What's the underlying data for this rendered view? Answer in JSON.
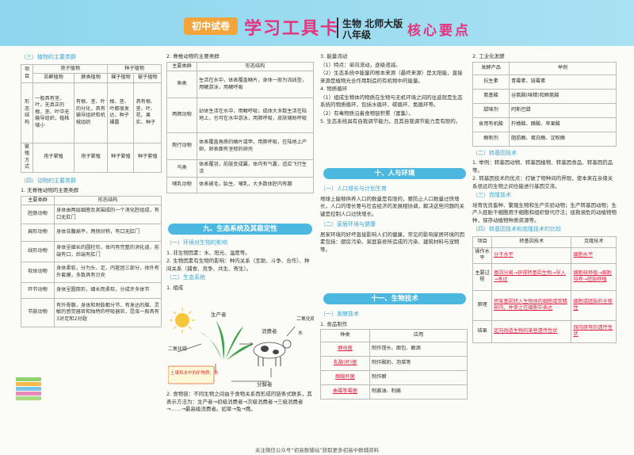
{
  "header": {
    "badge": "初中试卷",
    "title": "学习工具卡",
    "subject": "生物  北师大版",
    "grade": "八年级",
    "key": "核心要点"
  },
  "c1": {
    "t1": "（三）植物的主要类群",
    "plant_hdr": [
      "项目",
      "孢子植物",
      "种子植物"
    ],
    "plant_sub": [
      "苔藓植物",
      "蕨类植物",
      "裸子植物",
      "被子植物"
    ],
    "plant_r1": [
      "形态结构",
      "一般具有茎、叶，无真正的根，茎、叶中无输导组织，植株矮小",
      "有根、茎、叶的分化，具有输导组织和机械组织",
      "根、茎、叶都很发达，种子裸露",
      "具有根、茎、叶、花、果实、种子"
    ],
    "plant_r2": [
      "繁殖方式",
      "孢子繁殖",
      "孢子繁殖",
      "种子繁殖",
      "种子繁殖"
    ],
    "t2": "（四）动物的主要类群",
    "t3": "1. 无脊椎动物的主要类群",
    "inv_hdr": [
      "主要类群",
      "形态结构"
    ],
    "inv": [
      [
        "腔肠动物",
        "身体由两层细胞及其围成的一个消化腔组成，有口无肛门"
      ],
      [
        "扁形动物",
        "身体背腹扁平，两侧对称，有口无肛门"
      ],
      [
        "线形动物",
        "身体呈细长的圆柱形，体内有完整的消化道，前端有口，后端有肛门"
      ],
      [
        "软体动物",
        "身体柔软，分为头、足、内脏团三部分，体外有外套膜，多数具有贝壳"
      ],
      [
        "环节动物",
        "身体呈圆筒形，细长而柔软，分成许多体节"
      ],
      [
        "节肢动物",
        "有外骨骼，身体和附肢都分节，有发达的脑、灵敏的感觉器官和独特的呼吸器官，昆虫一般具有3对足和2对翅"
      ]
    ]
  },
  "c2": {
    "t1": "2. 脊椎动物的主要类群",
    "vert_hdr": [
      "主要类群",
      "形态结构"
    ],
    "vert": [
      [
        "鱼类",
        "生活在水中，体表覆盖鳞片，身体一般为流线型，用鳃游泳，用鳃呼吸"
      ],
      [
        "两栖动物",
        "幼体生活在水中，用鳃呼吸；成体大多数生活在陆地上，也可在水中游泳，用肺呼吸，皮肤辅助呼吸"
      ],
      [
        "爬行动物",
        "体表覆盖角质的鳞片或甲，用肺呼吸，在陆地上产卵，卵表面有坚韧的卵壳"
      ],
      [
        "鸟类",
        "体表覆羽，前肢变成翼，体内有气囊，适应飞行生活"
      ],
      [
        "哺乳动物",
        "体表被毛，胎生、哺乳，大多数体腔内有膈"
      ]
    ],
    "band": "九、生态系统及其稳定性",
    "t2": "（一）环境对生物的影响",
    "p1": "1. 非生物因素：水、阳光、温度等。",
    "p2": "2. 生物因素有生物的影响：种内关系（互助、斗争、合作）、种间关系（捕食、竞争、共生、寄生）。",
    "t3": "（二）生态系统",
    "p3": "1. 组成",
    "dia": {
      "producer": "生产者",
      "consumer": "消费者",
      "gas1": "二氧化碳",
      "gas2": "二氧化碳",
      "water": "水",
      "soil": "土壤和水中的矿物质、水",
      "decomposer": "分解者"
    },
    "p4": "2. 食物链：不同生物之间由于食物关系而形成的链条式联系，其表示方法为：生产者→初级消费者→次级消费者→三级消费者→……→最高级消费者。如草→兔→鹰。"
  },
  "c3": {
    "p1": "3. 能量流动",
    "p2": "（1）特点：单向流动，逐级递减。",
    "p3": "（2）生态系统中能量的根本来源（最终来源）是太阳能，直接来源是植物光合作用制造的有机物中的能量。",
    "p4": "4. 物质循环",
    "p5": "（1）组成生物体的物质在生物与无机环境之间的往返就是生态系统的物质循环，包括水循环、碳循环、氮循环等。",
    "p6": "（2）有毒物质沿着食物链积累（富集）。",
    "p7": "5. 生态系统具有自我调节能力，且其自我调节能力是有限的。",
    "band1": "十、人与环境",
    "t1": "（一）人口增长与计划生育",
    "p8": "地球上能够供养人口的数量是有限的，要防止人口数量过快增长，人口的增长要与社会经济的发展相协调，解决这些问题的关键是控制人口过快增长。",
    "t2": "（二）家居环境与健康",
    "p9": "居家环境的好坏直接影响人们的健康，常见的影响家居环境的因素包括：厨房污染、家庭装修所造成的污染、建筑材料与宠物等。",
    "band2": "十一、生物技术",
    "t3": "（一）发酵技术",
    "p10": "1. 食品制作",
    "food_hdr": [
      "种类",
      "应用"
    ],
    "food": [
      [
        "酵母菌",
        "制作馒头、面包、酿酒"
      ],
      [
        "乳酸(杆)菌",
        "制作酸奶、泡菜等"
      ],
      [
        "醋酸杆菌",
        "制作醋"
      ],
      [
        "曲霉等霉菌",
        "制酱油、制酱"
      ]
    ]
  },
  "c4": {
    "p1": "2. 工业化发酵",
    "ind_hdr": [
      "发酵产品",
      "举例"
    ],
    "ind": [
      [
        "抗生素",
        "青霉素、链霉素"
      ],
      [
        "氨基酸",
        "谷氨酸(味精)和赖氨酸"
      ],
      [
        "甜味剂",
        "阿斯巴甜"
      ],
      [
        "食用有机酸",
        "柠檬酸、醋酸、苹果酸"
      ],
      [
        "酶制剂",
        "脂肪酶、蛋白酶、淀粉酶"
      ]
    ],
    "t1": "（二）转基因技术",
    "p2": "1. 举例：转基因动物、转基因植物、转基因食品、转基因药品等。",
    "p3": "2. 转基因技术的优点：打破了物种间的界限，使本来在亲缘关系很远的生物之间也能进行基因交流。",
    "t2": "（三）克隆技术",
    "p4": "培育优良畜种、繁殖生物和生产实验动物；生产转基因动物；生产人胚胎干细胞用于细胞和组织替代疗法；拯救濒危的动植物物种，保存动植物种质资源等。",
    "t3": "（四）转基因技术和克隆技术的比较",
    "cmp_hdr": [
      "项目",
      "转基因技术",
      "克隆技术"
    ],
    "cmp": [
      [
        "操作水平",
        "分子水平",
        "细胞水平"
      ],
      [
        "主要过程",
        "基因分离→获得转基因生物→导入→表达",
        "细胞核移植→细胞培养→胚胎移植"
      ],
      [
        "原理",
        "将某基因转入生物体的细胞或受精卵内，并使之在细胞中表达",
        "细胞或胚胎的全能性"
      ],
      [
        "结果",
        "定向改造生物的某些遗传性状",
        "保持原有的遗传性状"
      ]
    ]
  },
  "footer": "关注微信公众号“初高数辅站”获取更多初高中数辅资料"
}
